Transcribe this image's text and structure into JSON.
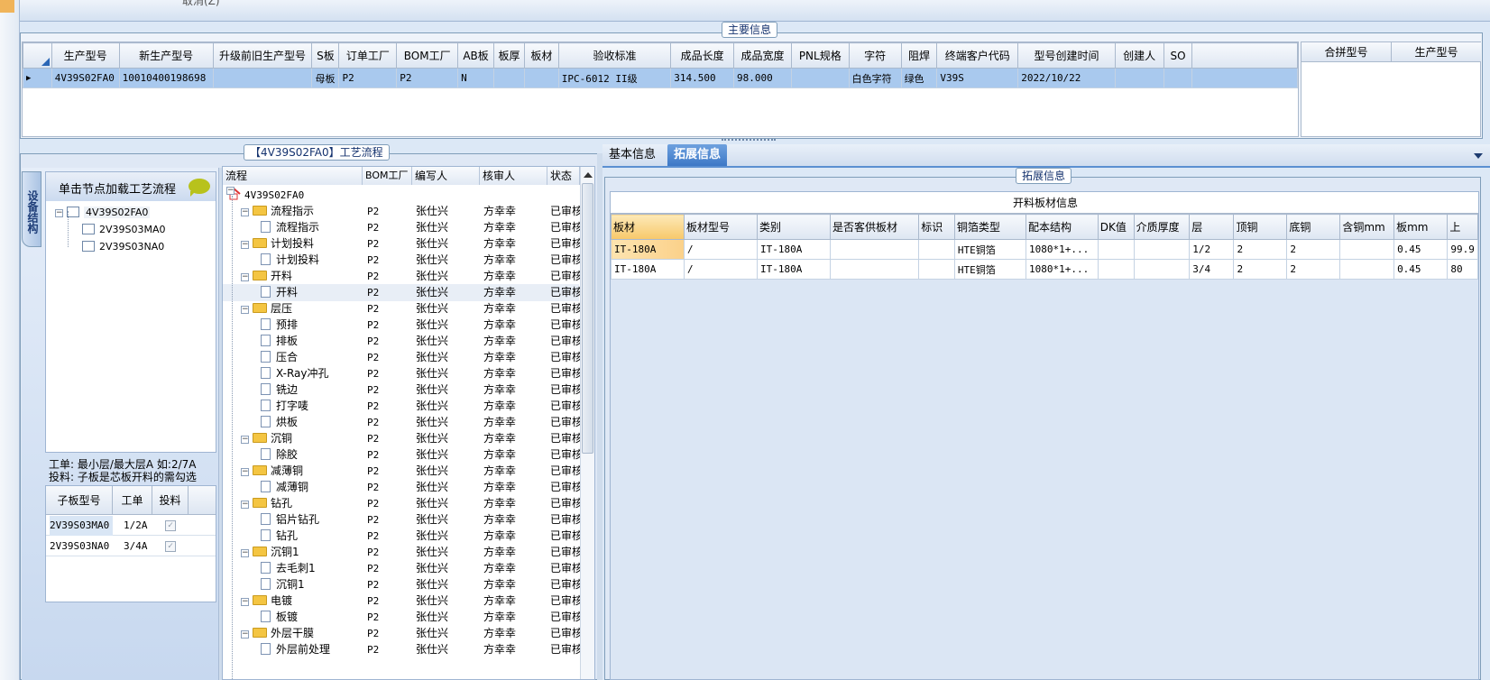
{
  "top": {
    "cut_text": "取消(Z)"
  },
  "main_info": {
    "legend": "主要信息",
    "columns": [
      "生产型号",
      "新生产型号",
      "升级前旧生产型号",
      "S板",
      "订单工厂",
      "BOM工厂",
      "AB板",
      "板厚",
      "板材",
      "验收标准",
      "成品长度",
      "成品宽度",
      "PNL规格",
      "字符",
      "阻焊",
      "终端客户代码",
      "型号创建时间",
      "创建人",
      "SO"
    ],
    "row": [
      "4V39S02FA0",
      "10010400198698",
      "",
      "母板",
      "P2",
      "P2",
      "N",
      "",
      "",
      "IPC-6012 II级",
      "314.500",
      "98.000",
      "",
      "白色字符",
      "绿色",
      "V39S",
      "2022/10/22",
      "",
      ""
    ],
    "side_columns": [
      "合拼型号",
      "生产型号"
    ]
  },
  "process_panel": {
    "legend": "【4V39S02FA0】工艺流程",
    "vtab_label": "设备结构",
    "hint": "单击节点加载工艺流程",
    "tree": [
      "4V39S02FA0",
      "2V39S03MA0",
      "2V39S03NA0"
    ],
    "note_line1": "工单: 最小层/最大层A 如:2/7A",
    "note_line2": "投料: 子板是芯板开料的需勾选",
    "sub_columns": [
      "子板型号",
      "工单",
      "投料"
    ],
    "sub_rows": [
      {
        "model": "2V39S03MA0",
        "order": "1/2A",
        "check": "✓"
      },
      {
        "model": "2V39S03NA0",
        "order": "3/4A",
        "check": "✓"
      }
    ]
  },
  "flow": {
    "columns": [
      "流程",
      "BOM工厂",
      "编写人",
      "核审人",
      "状态"
    ],
    "root": "4V39S02FA0",
    "rows": [
      {
        "level": 1,
        "name": "流程指示",
        "bom": "P2",
        "writer": "张仕兴",
        "reviewer": "方幸幸",
        "status": "已审核"
      },
      {
        "level": 2,
        "name": "流程指示",
        "bom": "P2",
        "writer": "张仕兴",
        "reviewer": "方幸幸",
        "status": "已审核"
      },
      {
        "level": 1,
        "name": "计划投料",
        "bom": "P2",
        "writer": "张仕兴",
        "reviewer": "方幸幸",
        "status": "已审核"
      },
      {
        "level": 2,
        "name": "计划投料",
        "bom": "P2",
        "writer": "张仕兴",
        "reviewer": "方幸幸",
        "status": "已审核"
      },
      {
        "level": 1,
        "name": "开料",
        "bom": "P2",
        "writer": "张仕兴",
        "reviewer": "方幸幸",
        "status": "已审核"
      },
      {
        "level": 2,
        "name": "开料",
        "bom": "P2",
        "writer": "张仕兴",
        "reviewer": "方幸幸",
        "status": "已审核",
        "selected": true
      },
      {
        "level": 1,
        "name": "层压",
        "bom": "P2",
        "writer": "张仕兴",
        "reviewer": "方幸幸",
        "status": "已审核"
      },
      {
        "level": 2,
        "name": "预排",
        "bom": "P2",
        "writer": "张仕兴",
        "reviewer": "方幸幸",
        "status": "已审核"
      },
      {
        "level": 2,
        "name": "排板",
        "bom": "P2",
        "writer": "张仕兴",
        "reviewer": "方幸幸",
        "status": "已审核"
      },
      {
        "level": 2,
        "name": "压合",
        "bom": "P2",
        "writer": "张仕兴",
        "reviewer": "方幸幸",
        "status": "已审核"
      },
      {
        "level": 2,
        "name": "X-Ray冲孔",
        "bom": "P2",
        "writer": "张仕兴",
        "reviewer": "方幸幸",
        "status": "已审核"
      },
      {
        "level": 2,
        "name": "铣边",
        "bom": "P2",
        "writer": "张仕兴",
        "reviewer": "方幸幸",
        "status": "已审核"
      },
      {
        "level": 2,
        "name": "打字唛",
        "bom": "P2",
        "writer": "张仕兴",
        "reviewer": "方幸幸",
        "status": "已审核"
      },
      {
        "level": 2,
        "name": "烘板",
        "bom": "P2",
        "writer": "张仕兴",
        "reviewer": "方幸幸",
        "status": "已审核"
      },
      {
        "level": 1,
        "name": "沉铜",
        "bom": "P2",
        "writer": "张仕兴",
        "reviewer": "方幸幸",
        "status": "已审核"
      },
      {
        "level": 2,
        "name": "除胶",
        "bom": "P2",
        "writer": "张仕兴",
        "reviewer": "方幸幸",
        "status": "已审核"
      },
      {
        "level": 1,
        "name": "减薄铜",
        "bom": "P2",
        "writer": "张仕兴",
        "reviewer": "方幸幸",
        "status": "已审核"
      },
      {
        "level": 2,
        "name": "减薄铜",
        "bom": "P2",
        "writer": "张仕兴",
        "reviewer": "方幸幸",
        "status": "已审核"
      },
      {
        "level": 1,
        "name": "钻孔",
        "bom": "P2",
        "writer": "张仕兴",
        "reviewer": "方幸幸",
        "status": "已审核"
      },
      {
        "level": 2,
        "name": "铝片钻孔",
        "bom": "P2",
        "writer": "张仕兴",
        "reviewer": "方幸幸",
        "status": "已审核"
      },
      {
        "level": 2,
        "name": "钻孔",
        "bom": "P2",
        "writer": "张仕兴",
        "reviewer": "方幸幸",
        "status": "已审核"
      },
      {
        "level": 1,
        "name": "沉铜1",
        "bom": "P2",
        "writer": "张仕兴",
        "reviewer": "方幸幸",
        "status": "已审核"
      },
      {
        "level": 2,
        "name": "去毛刺1",
        "bom": "P2",
        "writer": "张仕兴",
        "reviewer": "方幸幸",
        "status": "已审核"
      },
      {
        "level": 2,
        "name": "沉铜1",
        "bom": "P2",
        "writer": "张仕兴",
        "reviewer": "方幸幸",
        "status": "已审核"
      },
      {
        "level": 1,
        "name": "电镀",
        "bom": "P2",
        "writer": "张仕兴",
        "reviewer": "方幸幸",
        "status": "已审核"
      },
      {
        "level": 2,
        "name": "板镀",
        "bom": "P2",
        "writer": "张仕兴",
        "reviewer": "方幸幸",
        "status": "已审核"
      },
      {
        "level": 1,
        "name": "外层干膜",
        "bom": "P2",
        "writer": "张仕兴",
        "reviewer": "方幸幸",
        "status": "已审核"
      },
      {
        "level": 2,
        "name": "外层前处理",
        "bom": "P2",
        "writer": "张仕兴",
        "reviewer": "方幸幸",
        "status": "已审核"
      }
    ]
  },
  "tabs": [
    {
      "label": "基本信息",
      "active": false
    },
    {
      "label": "拓展信息",
      "active": true
    }
  ],
  "ext": {
    "legend": "拓展信息",
    "table_title": "开料板材信息",
    "columns": [
      "板材",
      "板材型号",
      "类别",
      "是否客供板材",
      "标识",
      "铜箔类型",
      "配本结构",
      "DK值",
      "介质厚度",
      "层",
      "顶铜",
      "底铜",
      "含铜mm",
      "板mm",
      "上"
    ],
    "rows": [
      [
        "IT-180A",
        "/",
        "IT-180A",
        "",
        "",
        "HTE铜箔",
        "1080*1+...",
        "",
        "",
        "1/2",
        "2",
        "2",
        "",
        "0.45",
        "99.9"
      ],
      [
        "IT-180A",
        "/",
        "IT-180A",
        "",
        "",
        "HTE铜箔",
        "1080*1+...",
        "",
        "",
        "3/4",
        "2",
        "2",
        "",
        "0.45",
        "80"
      ]
    ]
  }
}
